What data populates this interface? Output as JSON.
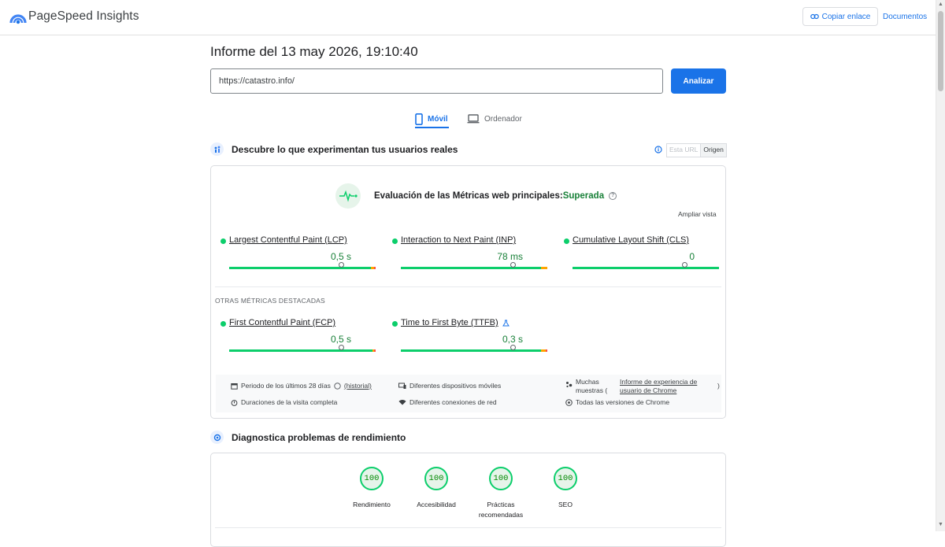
{
  "header": {
    "brand": "PageSpeed Insights",
    "copy_link": "Copiar enlace",
    "docs": "Documentos"
  },
  "report": {
    "title": "Informe del 13 may 2026, 19:10:40",
    "url": "https://catastro.info/",
    "analyze": "Analizar"
  },
  "tabs": {
    "mobile": "Móvil",
    "desktop": "Ordenador"
  },
  "field": {
    "heading": "Descubre lo que experimentan tus usuarios reales",
    "toggle_url": "Esta URL",
    "toggle_origin": "Origen",
    "assessment_prefix": "Evaluación de las Métricas web principales:",
    "assessment_result": "Superada",
    "expand": "Ampliar vista",
    "core_metrics": [
      {
        "label": "Largest Contentful Paint (LCP)",
        "value": "0,5 s"
      },
      {
        "label": "Interaction to Next Paint (INP)",
        "value": "78 ms"
      },
      {
        "label": "Cumulative Layout Shift (CLS)",
        "value": "0"
      }
    ],
    "other_title": "OTRAS MÉTRICAS DESTACADAS",
    "other_metrics": [
      {
        "label": "First Contentful Paint (FCP)",
        "value": "0,5 s"
      },
      {
        "label": "Time to First Byte (TTFB)",
        "value": "0,3 s"
      }
    ],
    "footer": {
      "period": "Periodo de los últimos 28 días",
      "history": "(historial)",
      "devices": "Diferentes dispositivos móviles",
      "samples_prefix": "Muchas muestras (",
      "samples_link": "Informe de experiencia de usuario de Chrome",
      "samples_suffix": ")",
      "durations": "Duraciones de la visita completa",
      "connections": "Diferentes conexiones de red",
      "versions": "Todas las versiones de Chrome"
    }
  },
  "diagnose": {
    "heading": "Diagnostica problemas de rendimiento",
    "scores": [
      {
        "value": "100",
        "label": "Rendimiento"
      },
      {
        "value": "100",
        "label": "Accesibilidad"
      },
      {
        "value": "100",
        "label": "Prácticas recomendadas"
      },
      {
        "value": "100",
        "label": "SEO"
      }
    ]
  },
  "colors": {
    "accent": "#1a73e8",
    "good": "#0cce6b",
    "good_text": "#188038"
  }
}
